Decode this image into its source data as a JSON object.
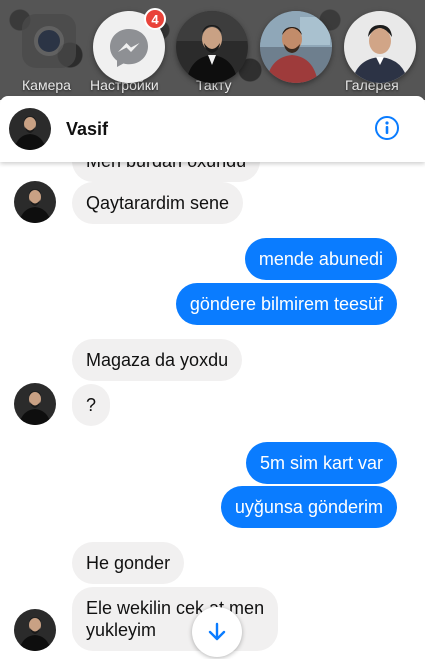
{
  "home": {
    "camera_label": "Камера",
    "settings_label": "Настройки",
    "taxi_label": "Такту",
    "gallery_label": "Галерея"
  },
  "chat_heads": {
    "unread_badge": "4",
    "icons": [
      "camera-icon",
      "messenger-icon"
    ]
  },
  "header": {
    "contact_name": "Vasif"
  },
  "messages": {
    "partial_top": "Men burdan oxundu",
    "m1": "Qaytarardim sene",
    "m2": "mende abunedi",
    "m3": "göndere bilmirem teesüf",
    "m4": "Magaza da yoxdu",
    "m5": "?",
    "m6": "5m sim kart var",
    "m7": "uyğunsa gönderim",
    "m8": "He gonder",
    "m9_line1": "Ele wekilin cek at men",
    "m9_line2": "yukleyim"
  },
  "colors": {
    "outgoing_bubble": "#0a7cff",
    "incoming_bubble": "#f1f0f0",
    "badge": "#e9433a",
    "info_icon": "#0a7cff"
  }
}
